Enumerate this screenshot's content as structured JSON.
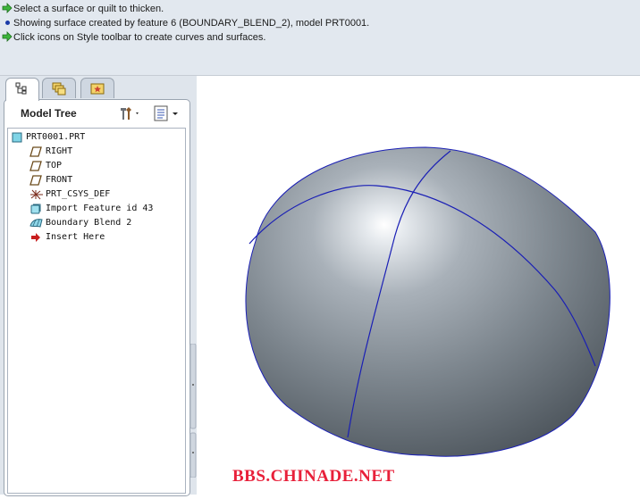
{
  "messages": [
    {
      "icon": "green-arrow-icon",
      "text": "Select a surface or quilt to thicken."
    },
    {
      "icon": "blue-dot-icon",
      "text": "Showing surface created by feature 6 (BOUNDARY_BLEND_2), model PRT0001."
    },
    {
      "icon": "green-arrow-icon",
      "text": "Click icons on Style toolbar to create curves and surfaces."
    }
  ],
  "tabs": [
    {
      "name": "model-tree-tab",
      "icon": "tree-icon",
      "active": true
    },
    {
      "name": "folder-browser-tab",
      "icon": "folders-icon",
      "active": false
    },
    {
      "name": "favorites-tab",
      "icon": "star-folder-icon",
      "active": false
    }
  ],
  "model_tree": {
    "title": "Model Tree",
    "settings_icon": "tools-icon",
    "show_icon": "list-icon",
    "items": [
      {
        "label": "PRT0001.PRT",
        "icon": "part-icon"
      },
      {
        "label": "RIGHT",
        "icon": "datum-plane-icon"
      },
      {
        "label": "TOP",
        "icon": "datum-plane-icon"
      },
      {
        "label": "FRONT",
        "icon": "datum-plane-icon"
      },
      {
        "label": "PRT_CSYS_DEF",
        "icon": "csys-icon"
      },
      {
        "label": "Import Feature id 43",
        "icon": "import-feature-icon"
      },
      {
        "label": "Boundary Blend 2",
        "icon": "boundary-blend-icon"
      },
      {
        "label": "Insert Here",
        "icon": "insert-arrow-icon"
      }
    ]
  },
  "viewport": {
    "surface_color": "#8e979f",
    "curve_color": "#1a1fb5"
  },
  "watermark": "BBS.CHINADE.NET"
}
